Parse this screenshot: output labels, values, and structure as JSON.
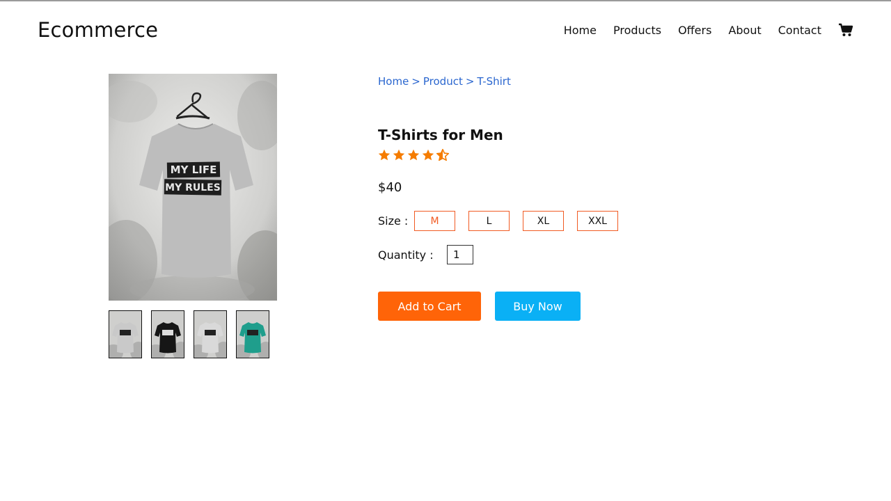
{
  "header": {
    "logo": "Ecommerce",
    "nav": [
      "Home",
      "Products",
      "Offers",
      "About",
      "Contact"
    ],
    "cart_icon": "shopping-cart-icon"
  },
  "breadcrumb": [
    "Home",
    "Product",
    "T-Shirt"
  ],
  "breadcrumb_separator": ">",
  "product": {
    "title": "T-Shirts for Men",
    "rating": 4.5,
    "rating_max": 5,
    "price": "$40",
    "image_text": [
      "MY LIFE",
      "MY RULES"
    ],
    "thumbnails": [
      {
        "color": "#c9c9c9",
        "label": "grey t-shirt"
      },
      {
        "color": "#161616",
        "label": "black t-shirt"
      },
      {
        "color": "#d9d9d9",
        "label": "light grey t-shirt"
      },
      {
        "color": "#1f9e8c",
        "label": "teal t-shirt"
      }
    ]
  },
  "size": {
    "label": "Size :",
    "options": [
      "M",
      "L",
      "XL",
      "XXL"
    ],
    "selected": "M"
  },
  "quantity": {
    "label": "Quantity :",
    "value": "1"
  },
  "actions": {
    "add_to_cart": "Add to Cart",
    "buy_now": "Buy Now"
  },
  "colors": {
    "accent": "#f15a22",
    "star": "#f57c00",
    "link": "#2a66cf",
    "add_to_cart": "#ff6408",
    "buy_now": "#0ab0f5"
  }
}
